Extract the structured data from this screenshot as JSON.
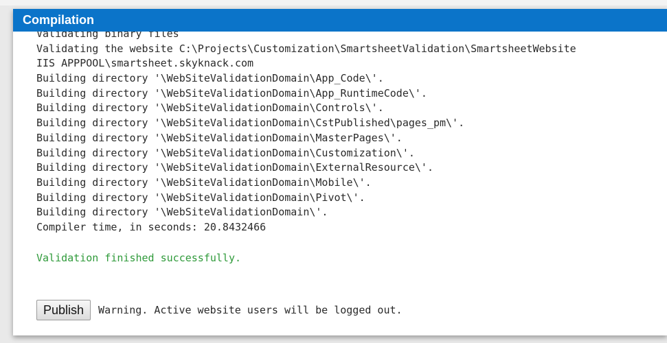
{
  "dialog": {
    "title": "Compilation",
    "title_bg": "#0b74c9"
  },
  "log": {
    "lines": [
      "Validating binary files",
      "Validating the website C:\\Projects\\Customization\\SmartsheetValidation\\SmartsheetWebsite",
      "IIS APPPOOL\\smartsheet.skyknack.com",
      "Building directory '\\WebSiteValidationDomain\\App_Code\\'.",
      "Building directory '\\WebSiteValidationDomain\\App_RuntimeCode\\'.",
      "Building directory '\\WebSiteValidationDomain\\Controls\\'.",
      "Building directory '\\WebSiteValidationDomain\\CstPublished\\pages_pm\\'.",
      "Building directory '\\WebSiteValidationDomain\\MasterPages\\'.",
      "Building directory '\\WebSiteValidationDomain\\Customization\\'.",
      "Building directory '\\WebSiteValidationDomain\\ExternalResource\\'.",
      "Building directory '\\WebSiteValidationDomain\\Mobile\\'.",
      "Building directory '\\WebSiteValidationDomain\\Pivot\\'.",
      "Building directory '\\WebSiteValidationDomain\\'.",
      "Compiler time, in seconds: 20.8432466"
    ],
    "success_message": "Validation finished successfully.",
    "success_color": "#2f9a3a"
  },
  "actions": {
    "publish_label": "Publish",
    "warning_text": "Warning. Active website users will be logged out."
  }
}
